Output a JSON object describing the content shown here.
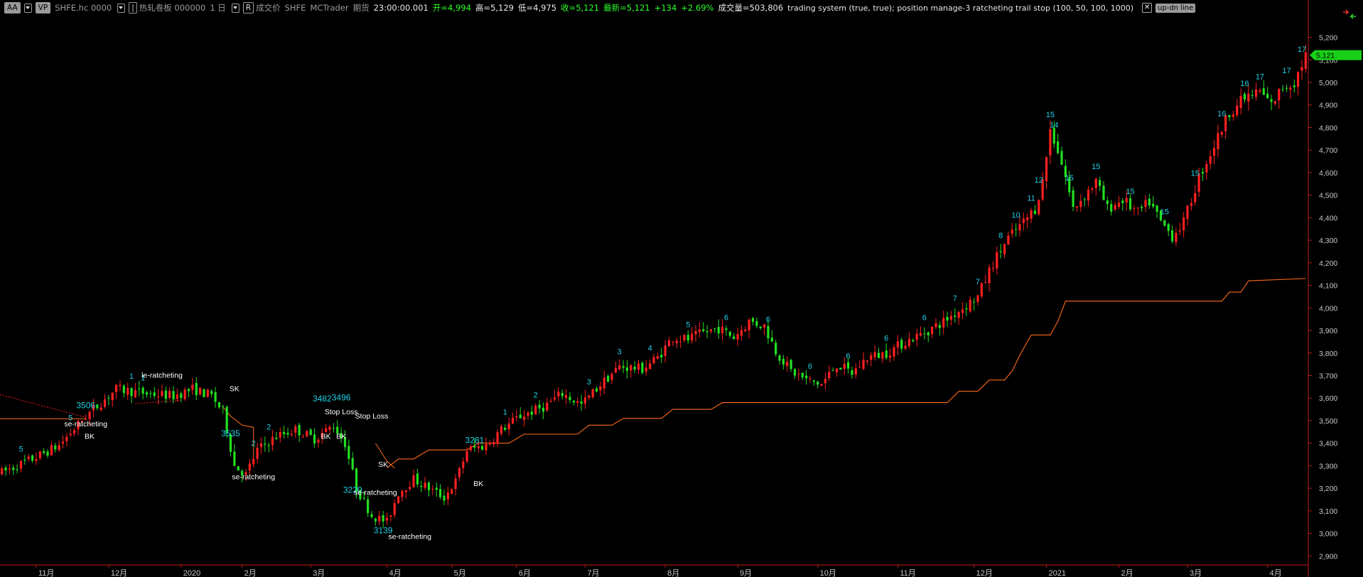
{
  "toolbar": {
    "aa": "AA",
    "vp": "VP",
    "symbol": "SHFE.hc 0000",
    "contract": "热轧卷板 000000",
    "period": "1 日",
    "r_btn": "R",
    "price_type": "成交价",
    "exchange": "SHFE",
    "platform": "MCTrader",
    "market": "期货",
    "time": "23:00:00.001",
    "open": "开=4,994",
    "high": "高=5,129",
    "low": "低=4,975",
    "close": "收=5,121",
    "last": "最新=5,121",
    "change": "+134",
    "change_pct": "+2.69%",
    "volume": "成交量=503,806",
    "strategy": "trading system (true,  true); position manage-3 ratcheting trail stop (100,  50,  100,  1000)",
    "close_icon": "close-icon",
    "close_glyph": "✕",
    "updn": "up-dn line"
  },
  "colors": {
    "up": "#ff2020",
    "down": "#22e022",
    "stop_line": "#ff6a1a",
    "label": "#1fd0e8",
    "axis": "#c0171b",
    "price_tag": "#19d019"
  },
  "chart_data": {
    "type": "candlestick",
    "y_ticks": [
      2900,
      3000,
      3100,
      3200,
      3300,
      3400,
      3500,
      3600,
      3700,
      3800,
      3900,
      4000,
      4100,
      4200,
      4300,
      4400,
      4500,
      4600,
      4700,
      4800,
      4900,
      5000,
      5100,
      5200
    ],
    "y_tick_labels": [
      "2,900",
      "3,000",
      "3,100",
      "3,200",
      "3,300",
      "3,400",
      "3,500",
      "3,600",
      "3,700",
      "3,800",
      "3,900",
      "4,000",
      "4,100",
      "4,200",
      "4,300",
      "4,400",
      "4,500",
      "4,600",
      "4,700",
      "4,800",
      "4,900",
      "5,000",
      "5,100",
      "5,200"
    ],
    "ylim": [
      2860,
      5290
    ],
    "last_price_label": "5,121",
    "last_price": 5121,
    "x_month_labels": [
      "11月",
      "12月",
      "2020",
      "2月",
      "3月",
      "4月",
      "5月",
      "6月",
      "7月",
      "8月",
      "9月",
      "10月",
      "11月",
      "12月",
      "2021",
      "2月",
      "3月",
      "4月"
    ],
    "bar_count": 343,
    "month_start_bars": [
      9,
      28,
      47,
      63,
      81,
      101,
      118,
      135,
      153,
      174,
      193,
      214,
      235,
      255,
      274,
      293,
      311,
      332
    ],
    "price_path": [
      [
        0,
        3270
      ],
      [
        8,
        3330
      ],
      [
        15,
        3390
      ],
      [
        22,
        3520
      ],
      [
        30,
        3640
      ],
      [
        38,
        3620
      ],
      [
        45,
        3610
      ],
      [
        50,
        3640
      ],
      [
        55,
        3610
      ],
      [
        58,
        3540
      ],
      [
        61,
        3300
      ],
      [
        64,
        3260
      ],
      [
        67,
        3370
      ],
      [
        72,
        3430
      ],
      [
        77,
        3460
      ],
      [
        82,
        3420
      ],
      [
        87,
        3480
      ],
      [
        90,
        3400
      ],
      [
        93,
        3200
      ],
      [
        97,
        3080
      ],
      [
        101,
        3050
      ],
      [
        104,
        3180
      ],
      [
        108,
        3240
      ],
      [
        113,
        3190
      ],
      [
        116,
        3160
      ],
      [
        119,
        3230
      ],
      [
        122,
        3370
      ],
      [
        127,
        3390
      ],
      [
        131,
        3460
      ],
      [
        136,
        3520
      ],
      [
        142,
        3560
      ],
      [
        147,
        3620
      ],
      [
        152,
        3570
      ],
      [
        157,
        3660
      ],
      [
        162,
        3740
      ],
      [
        168,
        3730
      ],
      [
        172,
        3780
      ],
      [
        176,
        3870
      ],
      [
        180,
        3860
      ],
      [
        184,
        3890
      ],
      [
        188,
        3910
      ],
      [
        192,
        3870
      ],
      [
        196,
        3940
      ],
      [
        200,
        3920
      ],
      [
        203,
        3810
      ],
      [
        207,
        3720
      ],
      [
        211,
        3680
      ],
      [
        215,
        3660
      ],
      [
        219,
        3750
      ],
      [
        223,
        3710
      ],
      [
        227,
        3780
      ],
      [
        232,
        3800
      ],
      [
        237,
        3850
      ],
      [
        242,
        3890
      ],
      [
        247,
        3940
      ],
      [
        252,
        4000
      ],
      [
        256,
        4050
      ],
      [
        260,
        4200
      ],
      [
        264,
        4310
      ],
      [
        268,
        4380
      ],
      [
        271,
        4440
      ],
      [
        273,
        4560
      ],
      [
        275,
        4790
      ],
      [
        277,
        4700
      ],
      [
        279,
        4580
      ],
      [
        281,
        4440
      ],
      [
        284,
        4500
      ],
      [
        287,
        4560
      ],
      [
        290,
        4440
      ],
      [
        294,
        4480
      ],
      [
        298,
        4420
      ],
      [
        301,
        4470
      ],
      [
        304,
        4380
      ],
      [
        307,
        4320
      ],
      [
        310,
        4380
      ],
      [
        314,
        4580
      ],
      [
        318,
        4720
      ],
      [
        322,
        4870
      ],
      [
        326,
        4930
      ],
      [
        330,
        4960
      ],
      [
        333,
        4900
      ],
      [
        336,
        4980
      ],
      [
        339,
        5000
      ],
      [
        342,
        5121
      ]
    ],
    "stop_line": [
      [
        101,
        3290
      ],
      [
        104,
        3330
      ],
      [
        108,
        3330
      ],
      [
        112,
        3370
      ],
      [
        122,
        3370
      ],
      [
        125,
        3400
      ],
      [
        133,
        3400
      ],
      [
        137,
        3440
      ],
      [
        151,
        3440
      ],
      [
        154,
        3480
      ],
      [
        160,
        3480
      ],
      [
        163,
        3510
      ],
      [
        173,
        3510
      ],
      [
        176,
        3550
      ],
      [
        186,
        3550
      ],
      [
        189,
        3580
      ],
      [
        248,
        3580
      ],
      [
        251,
        3630
      ],
      [
        256,
        3630
      ],
      [
        259,
        3680
      ],
      [
        263,
        3680
      ],
      [
        265,
        3720
      ],
      [
        267,
        3790
      ],
      [
        270,
        3880
      ],
      [
        275,
        3880
      ],
      [
        277,
        3940
      ],
      [
        279,
        4030
      ],
      [
        311,
        4030
      ],
      [
        313,
        4030
      ],
      [
        320,
        4030
      ],
      [
        322,
        4070
      ],
      [
        325,
        4070
      ],
      [
        327,
        4120
      ],
      [
        342,
        4130
      ]
    ],
    "count_labels": [
      {
        "bar": 5,
        "text": "5"
      },
      {
        "bar": 18,
        "text": "5"
      },
      {
        "bar": 34,
        "text": "1"
      },
      {
        "bar": 37,
        "text": "1"
      },
      {
        "bar": 66,
        "text": "2"
      },
      {
        "bar": 70,
        "text": "2"
      },
      {
        "bar": 132,
        "text": "1"
      },
      {
        "bar": 140,
        "text": "2"
      },
      {
        "bar": 154,
        "text": "3"
      },
      {
        "bar": 162,
        "text": "3"
      },
      {
        "bar": 170,
        "text": "4"
      },
      {
        "bar": 180,
        "text": "5"
      },
      {
        "bar": 190,
        "text": "6"
      },
      {
        "bar": 201,
        "text": "6"
      },
      {
        "bar": 212,
        "text": "6"
      },
      {
        "bar": 222,
        "text": "6"
      },
      {
        "bar": 232,
        "text": "6"
      },
      {
        "bar": 242,
        "text": "6"
      },
      {
        "bar": 250,
        "text": "7"
      },
      {
        "bar": 256,
        "text": "7"
      },
      {
        "bar": 262,
        "text": "8"
      },
      {
        "bar": 266,
        "text": "10"
      },
      {
        "bar": 270,
        "text": "11"
      },
      {
        "bar": 272,
        "text": "12"
      },
      {
        "bar": 275,
        "text": "15"
      },
      {
        "bar": 276,
        "text": "14"
      },
      {
        "bar": 280,
        "text": "15"
      },
      {
        "bar": 287,
        "text": "15"
      },
      {
        "bar": 296,
        "text": "15"
      },
      {
        "bar": 305,
        "text": "15"
      },
      {
        "bar": 313,
        "text": "15"
      },
      {
        "bar": 320,
        "text": "16"
      },
      {
        "bar": 326,
        "text": "16"
      },
      {
        "bar": 330,
        "text": "17"
      },
      {
        "bar": 337,
        "text": "17"
      },
      {
        "bar": 341,
        "text": "17"
      }
    ],
    "annotations": [
      {
        "bar": 22,
        "price": 3555,
        "text": "3506",
        "kind": "level"
      },
      {
        "bar": 60,
        "price": 3430,
        "text": "3535",
        "kind": "level"
      },
      {
        "bar": 84,
        "price": 3585,
        "text": "3482",
        "kind": "level"
      },
      {
        "bar": 89,
        "price": 3590,
        "text": "3496",
        "kind": "level"
      },
      {
        "bar": 124,
        "price": 3400,
        "text": "3281",
        "kind": "level"
      },
      {
        "bar": 100,
        "price": 3000,
        "text": "3139",
        "kind": "level"
      },
      {
        "bar": 92,
        "price": 3180,
        "text": "3220",
        "kind": "level"
      },
      {
        "bar": 42,
        "price": 3690,
        "text": "le-ratcheting",
        "kind": "signal"
      },
      {
        "bar": 22,
        "price": 3475,
        "text": "se-ratcheting",
        "kind": "signal"
      },
      {
        "bar": 66,
        "price": 3240,
        "text": "se-ratcheting",
        "kind": "signal"
      },
      {
        "bar": 98,
        "price": 3170,
        "text": "se-ratcheting",
        "kind": "signal"
      },
      {
        "bar": 107,
        "price": 2975,
        "text": "se-ratcheting",
        "kind": "signal"
      },
      {
        "bar": 89,
        "price": 3528,
        "text": "Stop Loss",
        "kind": "signal"
      },
      {
        "bar": 97,
        "price": 3510,
        "text": "Stop Loss",
        "kind": "signal"
      },
      {
        "bar": 61,
        "price": 3630,
        "text": "SK",
        "kind": "signal"
      },
      {
        "bar": 100,
        "price": 3295,
        "text": "SK",
        "kind": "signal"
      },
      {
        "bar": 85,
        "price": 3420,
        "text": "BK",
        "kind": "signal"
      },
      {
        "bar": 89,
        "price": 3420,
        "text": "BK",
        "kind": "signal"
      },
      {
        "bar": 23,
        "price": 3420,
        "text": "BK",
        "kind": "signal"
      },
      {
        "bar": 125,
        "price": 3210,
        "text": "BK",
        "kind": "signal"
      }
    ],
    "xlabel": "",
    "ylabel": "",
    "title": ""
  }
}
